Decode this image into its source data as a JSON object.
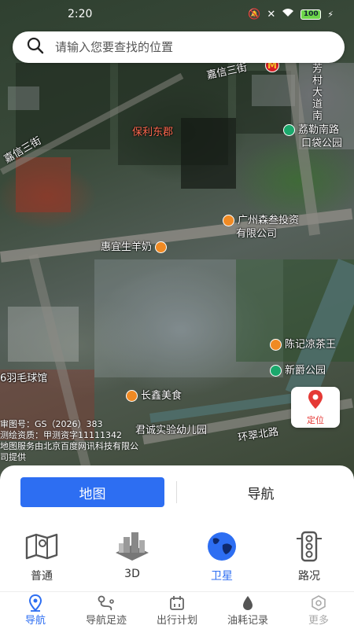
{
  "status_bar": {
    "time": "2:20",
    "battery": "100"
  },
  "search": {
    "placeholder": "请输入您要查找的位置"
  },
  "map_labels": {
    "jiaxin_street": "嘉信三街",
    "jiaxin_street_left": "嘉信三街",
    "fangcun_road": "芳村大道南",
    "poly_dongjun": "保利东郡",
    "lile_park": "荔勒南路",
    "lile_park_2": "口袋公园",
    "huiyi_milk": "惠宜生羊奶",
    "guangzhou_sensan": "广州森叁投资",
    "guangzhou_sensan_2": "有限公司",
    "chenji_tea": "陈记凉茶王",
    "xinjue_park": "新爵公园",
    "yumao_hall": "6羽毛球馆",
    "changxin_food": "长鑫美食",
    "juncheng_kindergarten": "君诚实验幼儿园",
    "huancui_road": "环翠北路"
  },
  "credits": {
    "line1": "审图号：GS（2026）383",
    "line2": "测绘资质：甲测资字11111342",
    "line3": "地图服务由北京百度网讯科技有限公",
    "line4": "司提供"
  },
  "locate": {
    "label": "定位"
  },
  "mode": {
    "map": "地图",
    "navigation": "导航"
  },
  "layers": [
    {
      "label": "普通",
      "icon": "map-icon"
    },
    {
      "label": "3D",
      "icon": "3d-buildings-icon"
    },
    {
      "label": "卫星",
      "icon": "globe-icon"
    },
    {
      "label": "路况",
      "icon": "traffic-light-icon"
    }
  ],
  "tabs": [
    {
      "label": "导航",
      "icon": "location-pin-icon"
    },
    {
      "label": "导航足迹",
      "icon": "footprint-route-icon"
    },
    {
      "label": "出行计划",
      "icon": "calendar-icon"
    },
    {
      "label": "油耗记录",
      "icon": "fuel-drop-icon"
    },
    {
      "label": "更多",
      "icon": "hexagon-more-icon"
    }
  ],
  "colors": {
    "accent": "#2d6ef2",
    "locate_red": "#e53935"
  }
}
